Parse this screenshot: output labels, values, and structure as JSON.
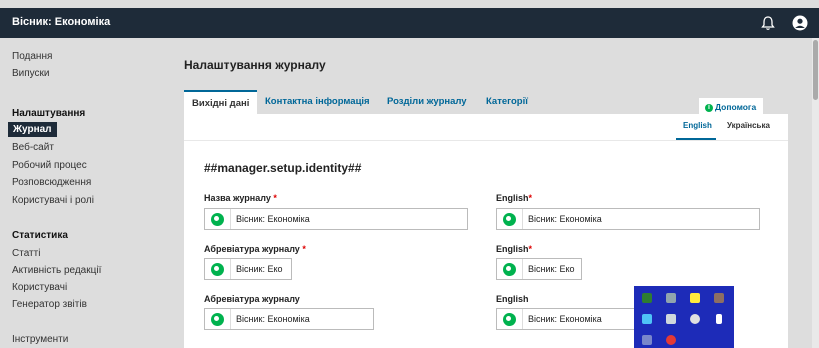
{
  "app": {
    "title": "Вісник: Економіка"
  },
  "header_icons": {
    "notifications": "bell-icon",
    "profile": "user-icon"
  },
  "sidebar": {
    "items": [
      {
        "label": "Подання"
      },
      {
        "label": "Випуски"
      },
      {
        "label": "Налаштування",
        "heading": true
      },
      {
        "label": "Журнал",
        "active": true
      },
      {
        "label": "Веб-сайт"
      },
      {
        "label": "Робочий процес"
      },
      {
        "label": "Розповсюдження"
      },
      {
        "label": "Користувачі і ролі"
      },
      {
        "label": "Статистика",
        "heading": true
      },
      {
        "label": "Статті"
      },
      {
        "label": "Активність редакції"
      },
      {
        "label": "Користувачі"
      },
      {
        "label": "Генератор звітів"
      },
      {
        "label": "Інструменти"
      }
    ]
  },
  "main": {
    "title": "Налаштування журналу",
    "tabs": [
      {
        "label": "Вихідні дані",
        "active": true
      },
      {
        "label": "Контактна інформація"
      },
      {
        "label": "Розділи журналу"
      },
      {
        "label": "Категорії"
      }
    ],
    "help": {
      "label": "Допомога",
      "icon": "info-icon"
    },
    "language_tabs": [
      {
        "label": "English",
        "active": true
      },
      {
        "label": "Українська"
      }
    ],
    "section_title": "##manager.setup.identity##",
    "fields": [
      {
        "label": "Назва журналу",
        "required": "*",
        "value": "Вісник: Економіка",
        "alt_label": "English",
        "alt_required": "*",
        "alt_value": "Вісник: Економіка"
      },
      {
        "label": "Абревіатура журналу",
        "required": "*",
        "value": "Вісник: Еко",
        "alt_label": "English",
        "alt_required": "*",
        "alt_value": "Вісник: Еко"
      },
      {
        "label": "Абревіатура журналу",
        "required": "",
        "value": "Вісник: Економіка",
        "alt_label": "English",
        "alt_required": "",
        "alt_value": "Вісник: Економіка"
      }
    ]
  },
  "colors": {
    "header_bg": "#1e2b39",
    "accent": "#006798",
    "required": "#dd0000",
    "globe": "#00b24e",
    "tray_bg": "#1d2bb8"
  }
}
